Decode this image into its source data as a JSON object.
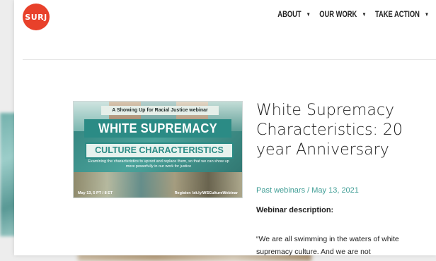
{
  "header": {
    "logo_text": "SURJ",
    "nav": [
      {
        "label": "ABOUT"
      },
      {
        "label": "OUR WORK"
      },
      {
        "label": "TAKE ACTION"
      }
    ],
    "caret_icon": "caret-down-icon"
  },
  "banner": {
    "tag": "A Showing Up for Racial Justice webinar",
    "title_line1": "WHITE SUPREMACY",
    "title_line2": "CULTURE CHARACTERISTICS",
    "subtitle": "Examining the characteristics to uproot and replace them, so that we can show up more powerfully in our work for justice",
    "date": "May 13, 5 PT / 8 ET",
    "register": "Register: bit.ly/WSCultureWebinar",
    "colors": {
      "teal": "#2b8b85",
      "light": "#e7f2ee"
    }
  },
  "post": {
    "title": "White Supremacy Characteristics: 20 year Anniversary",
    "meta": "Past webinars / May 13, 2021",
    "description_heading": "Webinar description:",
    "description_text": "“We are all swimming in the waters of white supremacy culture. And we are not"
  },
  "colors": {
    "brand": "#e8412b",
    "accent": "#3f9d95"
  }
}
